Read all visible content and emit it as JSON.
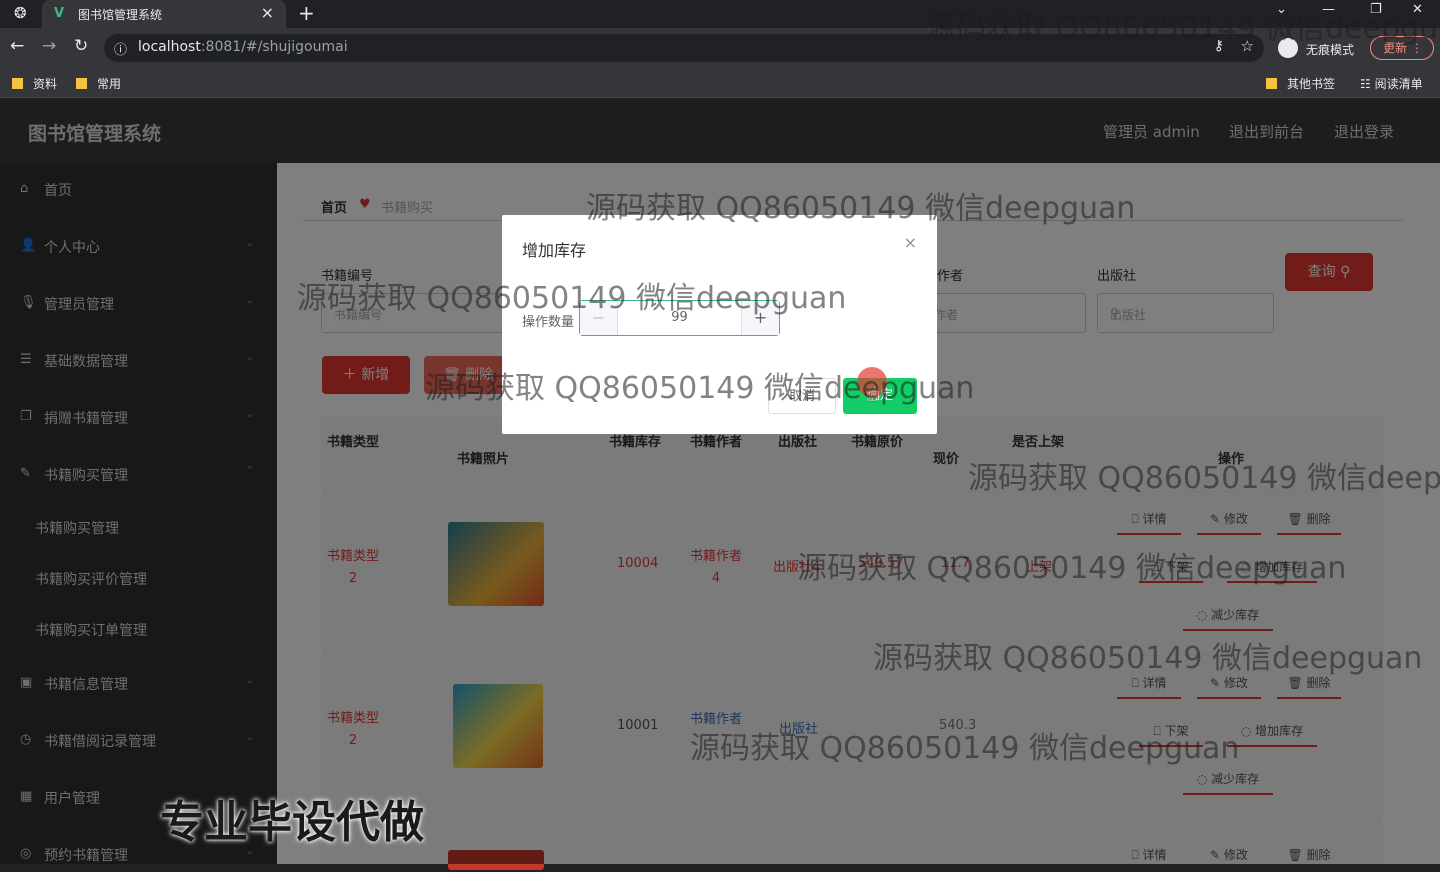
{
  "browser": {
    "tab_title": "图书馆管理系统",
    "tab_favicon": "V",
    "url_host": "localhost",
    "url_rest": ":8081/#/shujigoumai",
    "incognito_label": "无痕模式",
    "update_label": "更新",
    "bookmarks": [
      "资料",
      "常用"
    ],
    "other_bookmarks": "其他书签",
    "reading_list": "阅读清单"
  },
  "header": {
    "brand": "图书馆管理系统",
    "admin": "管理员 admin",
    "to_front": "退出到前台",
    "logout": "退出登录"
  },
  "sidebar": {
    "items": [
      {
        "label": "首页",
        "icon": "home-icon",
        "glyph": "⌂"
      },
      {
        "label": "个人中心",
        "icon": "user-icon",
        "glyph": "👤"
      },
      {
        "label": "管理员管理",
        "icon": "mic-icon",
        "glyph": "🎙"
      },
      {
        "label": "基础数据管理",
        "icon": "sliders-icon",
        "glyph": "☰"
      },
      {
        "label": "捐赠书籍管理",
        "icon": "copy-icon",
        "glyph": "❐"
      },
      {
        "label": "书籍购买管理",
        "icon": "edit-icon",
        "glyph": "✎"
      }
    ],
    "sub_items": [
      "书籍购买管理",
      "书籍购买评价管理",
      "书籍购买订单管理"
    ],
    "items2": [
      {
        "label": "书籍信息管理",
        "icon": "box-icon",
        "glyph": "▣"
      },
      {
        "label": "书籍借阅记录管理",
        "icon": "clock-icon",
        "glyph": "◷"
      },
      {
        "label": "用户管理",
        "icon": "grid-icon",
        "glyph": "▦"
      },
      {
        "label": "预约书籍管理",
        "icon": "compass-icon",
        "glyph": "◎"
      }
    ]
  },
  "breadcrumb": {
    "home": "首页",
    "current": "书籍购买"
  },
  "filters": {
    "labels": [
      "书籍编号",
      "作者",
      "出版社"
    ],
    "placeholders": [
      "书籍编号",
      "书籍作者",
      "出版社"
    ],
    "search_button": "查询"
  },
  "actions": {
    "add": "新增",
    "delete": "删除"
  },
  "table": {
    "headers": [
      "书籍类型",
      "书籍照片",
      "书籍库存",
      "书籍作者",
      "出版社",
      "书籍原价",
      "现价",
      "是否上架",
      "操作"
    ],
    "rows": [
      {
        "type": "书籍类型\n2",
        "stock": "10004",
        "author": "书籍作者\n4",
        "publisher": "出版社4",
        "orig": "549.57",
        "now": "11.7",
        "status": "上架"
      },
      {
        "type": "书籍类型\n2",
        "stock": "10001",
        "author": "书籍作者",
        "publisher": "出版社",
        "orig": "540.3",
        "now": "",
        "status": ""
      }
    ],
    "row_actions": [
      "详情",
      "修改",
      "删除",
      "下架",
      "增加库存",
      "减少库存"
    ]
  },
  "dialog": {
    "title": "增加库存",
    "quantity_label": "操作数量",
    "quantity_value": "99",
    "cancel": "取消",
    "confirm": "确定"
  },
  "watermark": "源码获取 QQ86050149 微信deepguan",
  "promo": "专业毕设代做"
}
